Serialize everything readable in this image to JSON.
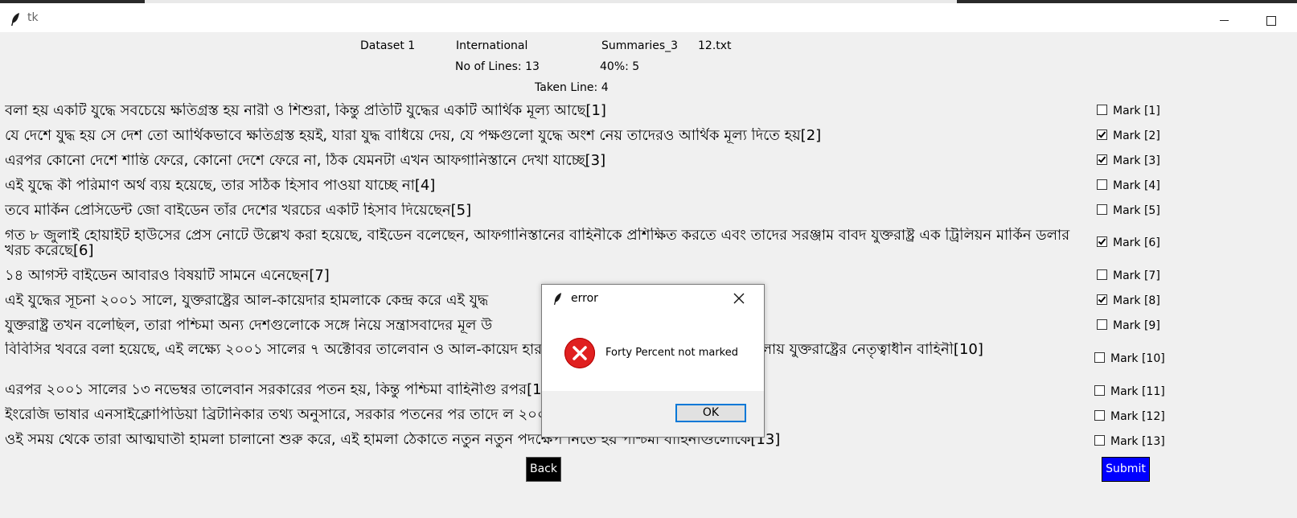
{
  "window": {
    "title": "tk"
  },
  "header": {
    "dataset": "Dataset 1",
    "category": "International",
    "summary": "Summaries_3",
    "file": "12.txt",
    "lines": "No of Lines: 13",
    "forty": "40%: 5",
    "taken": "Taken Line: 4"
  },
  "lines": [
    {
      "text": "বলা হয় একটি যুদ্ধে সবচেয়ে ক্ষতিগ্রস্ত হয় নারী ও শিশুরা, কিন্তু প্রতিটি যুদ্ধের একটি আর্থিক মূল্য আছে[1]",
      "mark": "Mark [1]",
      "checked": false
    },
    {
      "text": "যে দেশে যুদ্ধ হয় সে দেশ তো আর্থিকভাবে ক্ষতিগ্রস্ত হয়ই, যারা যুদ্ধ বাধিয়ে দেয়, যে পক্ষগুলো যুদ্ধে অংশ নেয় তাদেরও আর্থিক মূল্য দিতে হয়[2]",
      "mark": "Mark [2]",
      "checked": true
    },
    {
      "text": "এরপর কোনো দেশে শান্তি ফেরে, কোনো দেশে ফেরে না, ঠিক যেমনটা এখন আফগানিস্তানে দেখা যাচ্ছে[3]",
      "mark": "Mark [3]",
      "checked": true
    },
    {
      "text": "এই যুদ্ধে কী পরিমাণ অর্থ ব্যয় হয়েছে, তার সঠিক হিসাব পাওয়া যাচ্ছে না[4]",
      "mark": "Mark [4]",
      "checked": false
    },
    {
      "text": "তবে মার্কিন প্রেসিডেন্ট জো বাইডেন তাঁর দেশের খরচের একটি হিসাব দিয়েছেন[5]",
      "mark": "Mark [5]",
      "checked": false
    },
    {
      "text": "গত ৮ জুলাই হোয়াইট হাউসের প্রেস নোটে উল্লেখ করা হয়েছে, বাইডেন বলেছেন, আফগানিস্তানের বাহিনীকে প্রশিক্ষিত করতে এবং তাদের সরঞ্জাম বাবদ যুক্তরাষ্ট্র এক ট্রিলিয়ন মার্কিন ডলার খরচ করেছে[6]",
      "mark": "Mark [6]",
      "checked": true
    },
    {
      "text": "১৪ আগস্ট বাইডেন আবারও বিষয়টি সামনে এনেছেন[7]",
      "mark": "Mark [7]",
      "checked": false
    },
    {
      "text": "এই যুদ্ধের সূচনা ২০০১ সালে, যুক্তরাষ্ট্রের আল-কায়েদার হামলাকে কেন্দ্র করে এই যুদ্ধ",
      "mark": "Mark [8]",
      "checked": true
    },
    {
      "text": "যুক্তরাষ্ট্র তখন বলেছিল, তারা পশ্চিমা অন্য দেশগুলোকে সঙ্গে নিয়ে সন্ত্রাসবাদের মূল উ",
      "mark": "Mark [9]",
      "checked": false
    },
    {
      "text": "বিবিসির খবরে বলা হয়েছে, এই লক্ষ্যে ২০০১ সালের ৭ অক্টোবর তালেবান ও আল-কায়েদ                    হার ও জালালাবাদে প্রথম বিমান হামলা চালায় যুক্তরাষ্ট্রের নেতৃত্বাধীন বাহিনী[10]",
      "mark": "Mark [10]",
      "checked": false
    },
    {
      "text": "এরপর ২০০১ সালের ১৩ নভেম্বর তালেবান সরকারের পতন হয়, কিন্তু পশ্চিমা বাহিনীগু                                      রপর[11]",
      "mark": "Mark [11]",
      "checked": false
    },
    {
      "text": "ইংরেজি ভাষার এনসাইক্লোপিডিয়া ব্রিটানিকার তথ্য অনুসারে, সরকার পতনের পর তাদে                                       ল ২০০৫ সালের দিকে[12]",
      "mark": "Mark [12]",
      "checked": false
    },
    {
      "text": "ওই সময় থেকে তারা আত্মঘাতী হামলা চালানো শুরু করে, এই হামলা ঠেকাতে নতুন নতুন পদক্ষেপ নিতে হয় পশ্চিমা বাহিনীগুলোকে[13]",
      "mark": "Mark [13]",
      "checked": false
    }
  ],
  "buttons": {
    "back": "Back",
    "submit": "Submit"
  },
  "dialog": {
    "title": "error",
    "message": "Forty Percent not marked",
    "ok": "OK",
    "icon": "error-icon"
  }
}
